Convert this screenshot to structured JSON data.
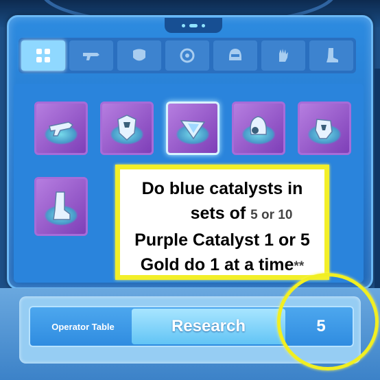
{
  "tabs": [
    {
      "name": "all",
      "icon": "grid-icon",
      "active": true
    },
    {
      "name": "weapon",
      "icon": "gun-icon",
      "active": false
    },
    {
      "name": "armor",
      "icon": "armor-icon",
      "active": false
    },
    {
      "name": "chip",
      "icon": "chip-icon",
      "active": false
    },
    {
      "name": "helmet",
      "icon": "helmet-icon",
      "active": false
    },
    {
      "name": "gloves",
      "icon": "glove-icon",
      "active": false
    },
    {
      "name": "boots",
      "icon": "boot-icon",
      "active": false
    }
  ],
  "items": [
    {
      "icon": "gun-item-icon"
    },
    {
      "icon": "armor-item-icon"
    },
    {
      "icon": "crystal-item-icon",
      "selected": true
    },
    {
      "icon": "helmet-item-icon"
    },
    {
      "icon": "glove-item-icon"
    },
    {
      "icon": "boot-item-icon"
    }
  ],
  "annotation": {
    "line1": "Do blue catalysts in",
    "line2_prefix": "sets of ",
    "line2_small": "5 or 10",
    "line3": "Purple Catalyst 1 or 5",
    "line4": "Gold do 1 at a time",
    "line4_suffix": "**"
  },
  "bottom": {
    "operator_label": "Operator Table",
    "research_label": "Research",
    "count": "5"
  },
  "colors": {
    "panel": "#2a84dc",
    "slot_purple": "#9a5ad0",
    "highlight_yellow": "#f2ef29"
  }
}
